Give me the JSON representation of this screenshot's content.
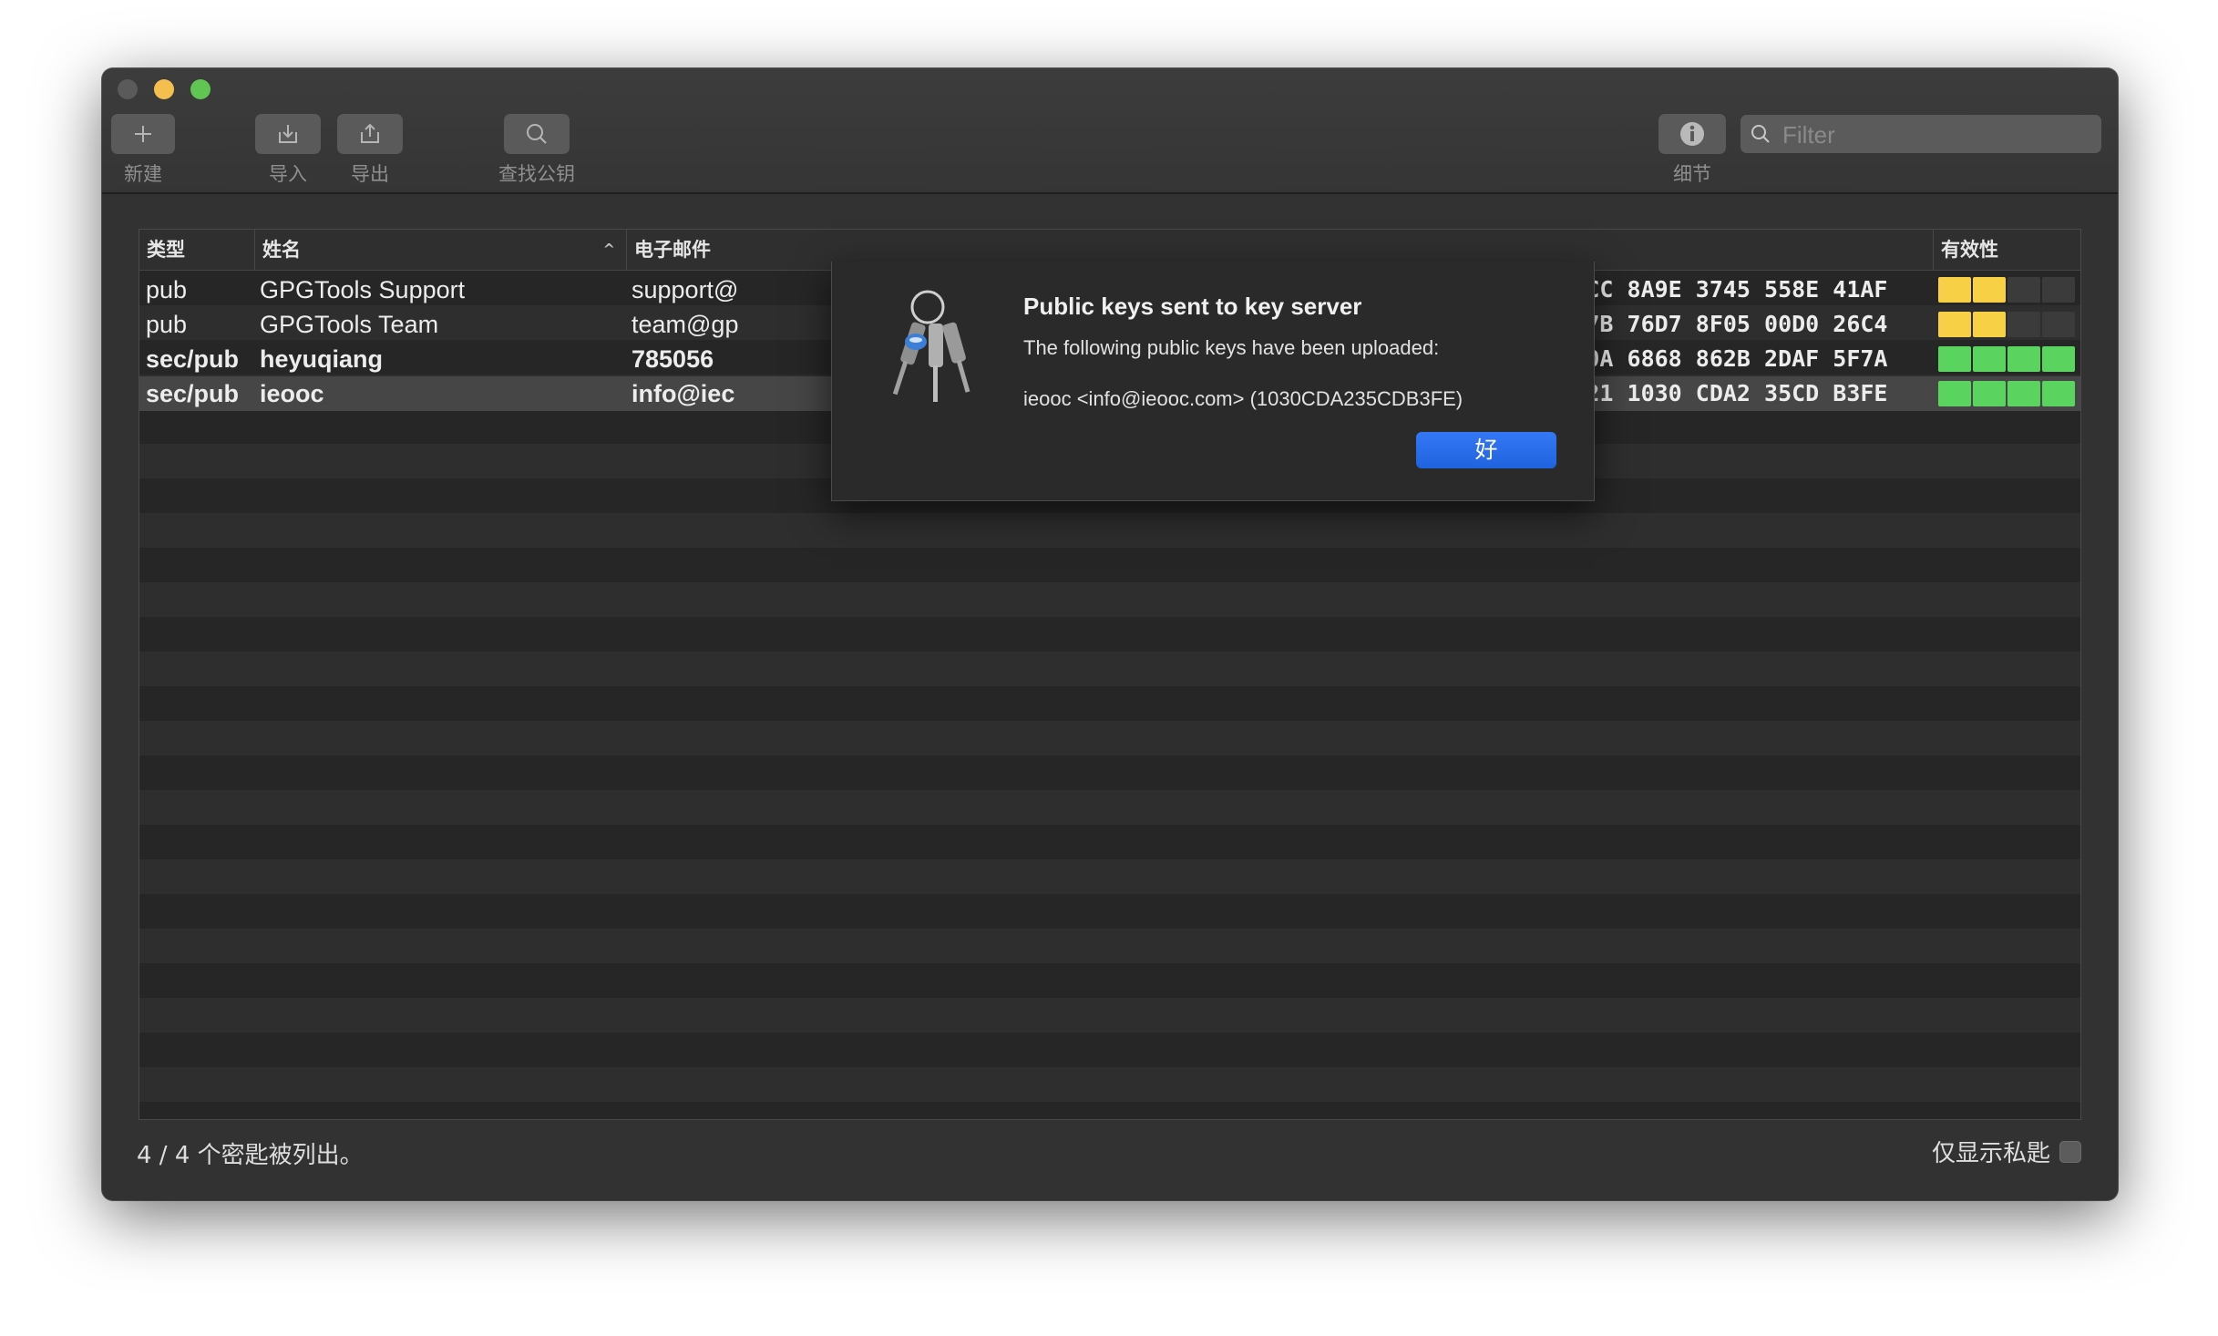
{
  "toolbar": {
    "new_label": "新建",
    "import_label": "导入",
    "export_label": "导出",
    "lookup_label": "查找公钥",
    "details_label": "细节",
    "filter_placeholder": "Filter"
  },
  "table": {
    "columns": {
      "type": "类型",
      "name": "姓名",
      "email": "电子邮件",
      "validity": "有效性"
    },
    "rows": [
      {
        "type": "pub",
        "name": "GPGTools Support",
        "email": "support@",
        "fingerprint": "970D  37CC  8A9E  3745  558E  41AF",
        "validity": "yellow",
        "selected": false
      },
      {
        "type": "pub",
        "name": "GPGTools Team",
        "email": "team@gp",
        "fingerprint": "EC9F  B07B  76D7  8F05  00D0  26C4",
        "validity": "yellow",
        "selected": false
      },
      {
        "type": "sec/pub",
        "name": "heyuqiang",
        "email": "785056",
        "fingerprint": "1730  960A  6868  862B  2DAF  5F7A",
        "validity": "green",
        "selected": false
      },
      {
        "type": "sec/pub",
        "name": "ieooc",
        "email": "info@iec",
        "fingerprint": "2AD3  0E21  1030  CDA2  35CD  B3FE",
        "validity": "green",
        "selected": true
      }
    ]
  },
  "validity_colors": {
    "yellow": "#f7d046",
    "green": "#5ad45f",
    "empty": "#3b3b3b"
  },
  "status": {
    "count_text": "4 / 4 个密匙被列出。",
    "private_only_label": "仅显示私匙"
  },
  "dialog": {
    "title": "Public keys sent to key server",
    "message": "The following public keys have been uploaded:",
    "key_line": "ieooc <info@ieooc.com> (1030CDA235CDB3FE)",
    "ok_label": "好"
  }
}
